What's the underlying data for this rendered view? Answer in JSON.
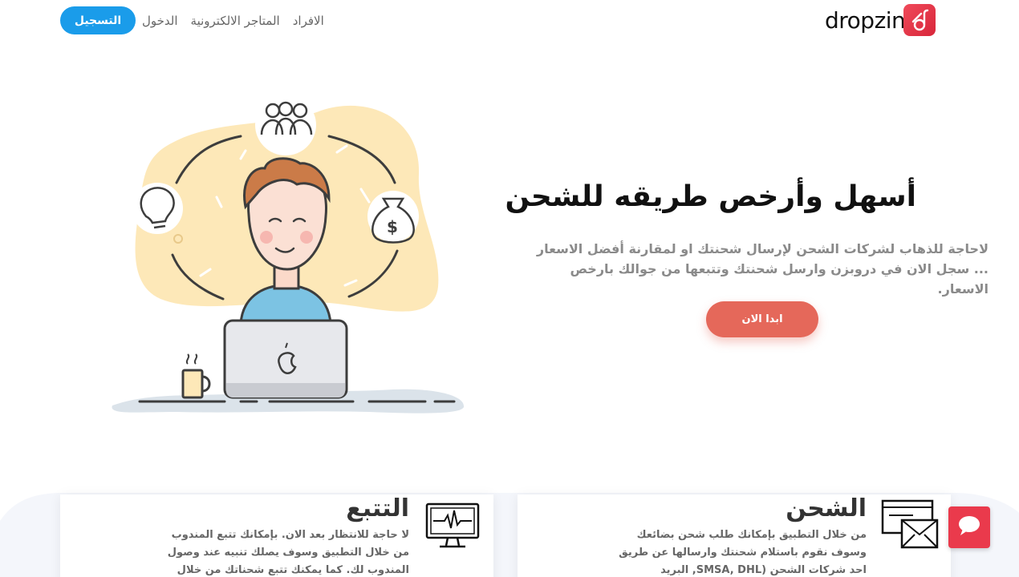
{
  "header": {
    "logo_text": "dropzin",
    "logo_icon": "dropzin-logo-icon",
    "nav": {
      "register_label": "التسجيل",
      "login_label": "الدخول",
      "stores_label": "المتاجر الالكترونية",
      "individuals_label": "الافراد"
    }
  },
  "hero": {
    "title": "أسهل وأرخص طريقه للشحن",
    "description": "لاحاجة للذهاب لشركات الشحن لإرسال شحنتك او لمقارنة أفضل الاسعار ... سجل الان في دروبزن وارسل شحنتك وتتبعها من جوالك بارخص الاسعار.",
    "cta_label": "ابدا الان",
    "illustration": "person-with-laptop-illustration"
  },
  "features": {
    "tracking": {
      "title": "التتبع",
      "text": "لا حاجة للانتظار بعد الان. بإمكانك تتبع المندوب من خلال التطبيق وسوف يصلك تنبيه عند وصول المندوب لك. كما يمكنك تتبع شحناتك من خلال",
      "icon": "monitor-pulse-icon"
    },
    "shipping": {
      "title": "الشحن",
      "text": "من خلال التطبيق بإمكانك طلب شحن بضائعك وسوف نقوم باستلام شحنتك وارسالها عن طريق احد شركات الشحن (SMSA, DHL, البريد السعودي)",
      "icon": "package-envelope-icon"
    }
  },
  "chat": {
    "icon": "chat-bubble-icon"
  },
  "colors": {
    "primary_blue": "#1a9cea",
    "cta_red": "#e5685a",
    "brand_red": "#e23a4c"
  }
}
